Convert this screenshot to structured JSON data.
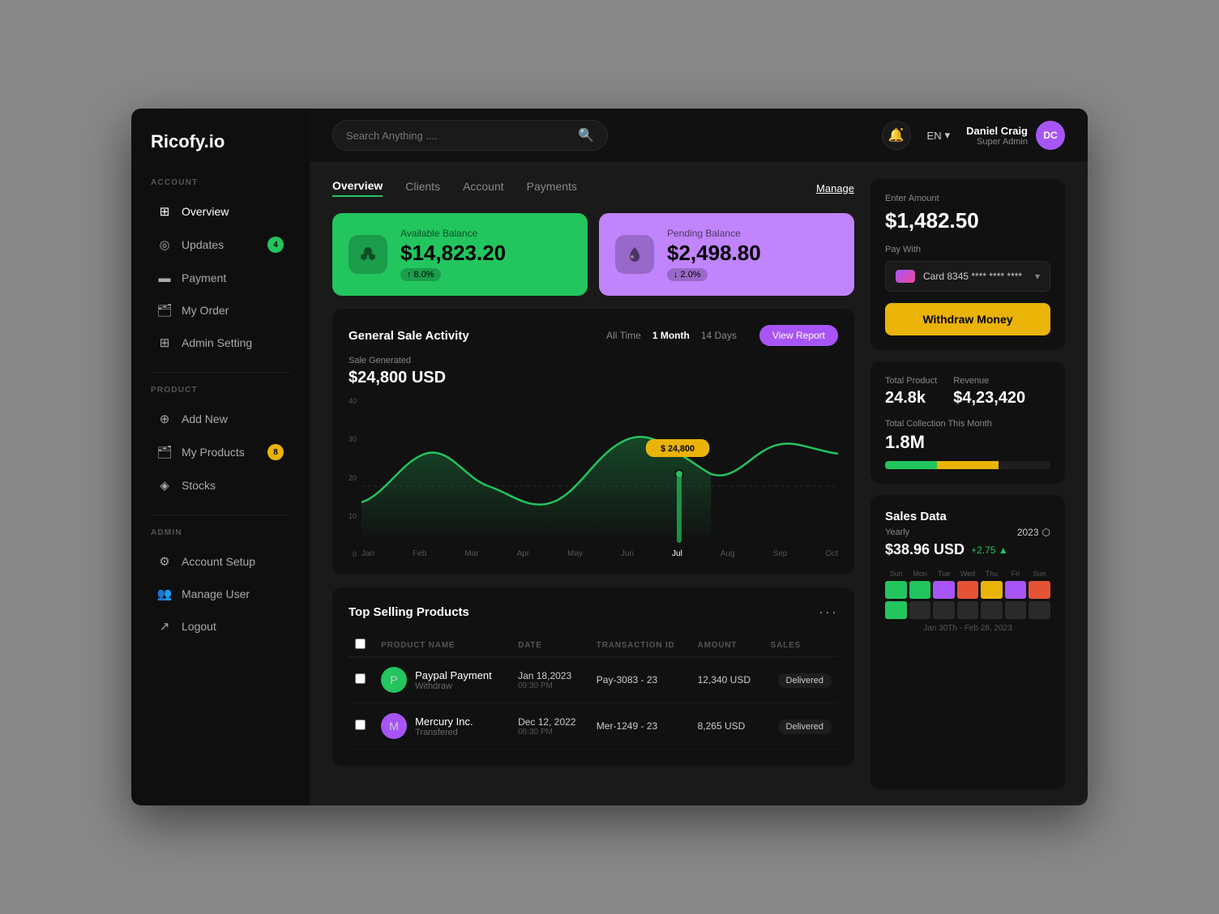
{
  "app": {
    "logo": "Ricofy.io"
  },
  "topbar": {
    "search_placeholder": "Search Anything ....",
    "language": "EN",
    "user": {
      "name": "Daniel Craig",
      "role": "Super Admin",
      "initials": "DC"
    }
  },
  "sidebar": {
    "sections": [
      {
        "label": "ACCOUNT",
        "items": [
          {
            "id": "overview",
            "label": "Overview",
            "icon": "⊞",
            "active": true
          },
          {
            "id": "updates",
            "label": "Updates",
            "icon": "◎",
            "badge": "4",
            "badge_color": "green"
          },
          {
            "id": "payment",
            "label": "Payment",
            "icon": "▬"
          },
          {
            "id": "my-order",
            "label": "My Order",
            "icon": "🗂"
          },
          {
            "id": "admin-setting",
            "label": "Admin Setting",
            "icon": "⊞"
          }
        ]
      },
      {
        "label": "PRODUCT",
        "items": [
          {
            "id": "add-new",
            "label": "Add New",
            "icon": "⊕"
          },
          {
            "id": "my-products",
            "label": "My Products",
            "icon": "🗂",
            "badge": "8",
            "badge_color": "yellow"
          },
          {
            "id": "stocks",
            "label": "Stocks",
            "icon": "◈"
          }
        ]
      },
      {
        "label": "ADMIN",
        "items": [
          {
            "id": "account-setup",
            "label": "Account Setup",
            "icon": "⚙"
          },
          {
            "id": "manage-user",
            "label": "Manage User",
            "icon": "👥"
          },
          {
            "id": "logout",
            "label": "Logout",
            "icon": "↗"
          }
        ]
      }
    ]
  },
  "tabs": [
    "Overview",
    "Clients",
    "Account",
    "Payments"
  ],
  "active_tab": "Overview",
  "manage_label": "Manage",
  "balance_cards": [
    {
      "label": "Available Balance",
      "amount": "$14,823.20",
      "badge": "↑ 8.0%",
      "color": "green",
      "icon": "👥"
    },
    {
      "label": "Pending Balance",
      "amount": "$2,498.80",
      "badge": "↓ 2.0%",
      "color": "purple",
      "icon": "💧"
    }
  ],
  "chart": {
    "title": "General Sale Activity",
    "time_filters": [
      "All Time",
      "1 Month",
      "14 Days"
    ],
    "active_filter": "1 Month",
    "sale_label": "Sale Generated",
    "sale_amount": "$24,800 USD",
    "view_report_label": "View Report",
    "tooltip_value": "$ 24,800",
    "x_labels": [
      "Jan",
      "Feb",
      "Mar",
      "Apr",
      "May",
      "Jun",
      "Jul",
      "Aug",
      "Sep",
      "Oct"
    ],
    "y_labels": [
      "40",
      "30",
      "20",
      "10",
      "0"
    ],
    "highlight_x": "Jul"
  },
  "top_selling": {
    "title": "Top Selling Products",
    "columns": [
      "PRODUCT NAME",
      "DATE",
      "TRANSACTION ID",
      "AMOUNT",
      "SALES"
    ],
    "rows": [
      {
        "name": "Paypal Payment",
        "sub": "Withdraw",
        "date": "Jan 18,2023",
        "time": "09:30 PM",
        "transaction_id": "Pay-3083 - 23",
        "amount": "12,340 USD",
        "status": "Delivered",
        "icon_bg": "#22c55e",
        "icon": "P"
      },
      {
        "name": "Mercury Inc.",
        "sub": "Transfered",
        "date": "Dec 12, 2022",
        "time": "08:30 PM",
        "transaction_id": "Mer-1249 - 23",
        "amount": "8,265 USD",
        "status": "Delivered",
        "icon_bg": "#a855f7",
        "icon": "M"
      }
    ]
  },
  "right_panel": {
    "enter_amount_label": "Enter Amount",
    "amount": "$1,482.50",
    "pay_with_label": "Pay With",
    "card_number": "Card 8345 **** **** ****",
    "withdraw_label": "Withdraw Money",
    "total_product_label": "Total Product",
    "total_product_value": "24.8k",
    "revenue_label": "Revenue",
    "revenue_value": "$4,23,420",
    "total_collection_label": "Total Collection This Month",
    "total_collection_value": "1.8M"
  },
  "sales_data": {
    "title": "Sales Data",
    "yearly_label": "Yearly",
    "year": "2023",
    "amount": "$38.96 USD",
    "change": "+2.75 ▲",
    "date_range": "Jan 30Th - Feb 28, 2023",
    "day_labels": [
      "Sun",
      "Mon",
      "Tue",
      "Wed",
      "Thu",
      "Fri",
      "Sun"
    ],
    "calendar_colors": [
      "#22c55e",
      "#22c55e",
      "#a855f7",
      "#e55",
      "#eab308",
      "#a855f7",
      "#e55",
      "#22c55e",
      "#888",
      "#888",
      "#888",
      "#888",
      "#888",
      "#888"
    ]
  }
}
